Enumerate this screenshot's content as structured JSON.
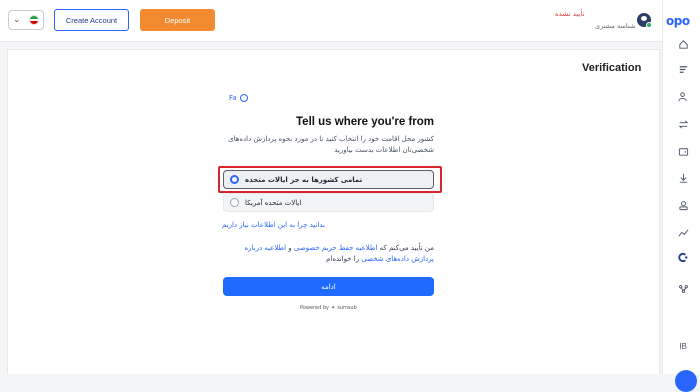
{
  "header": {
    "create_account_label": "Create Account",
    "deposit_label": "Deposit",
    "verification_status": "تأیید نشده",
    "account_label": "شناسه مشتری"
  },
  "sidebar": {
    "logo": "opo",
    "ib_label": "IB"
  },
  "page": {
    "title": "Verification",
    "language_link": "Fa"
  },
  "form": {
    "heading": "Tell us where you're from",
    "description": "کشور محل اقامت خود را انتخاب کنید تا در مورد نحوه پردازش داده‌های شخصی‌تان اطلاعات بدست بیاورید",
    "options": [
      {
        "label": "تمامی کشورها به جز ایالات متحده",
        "selected": true
      },
      {
        "label": "ایالات متحده آمریکا",
        "selected": false
      }
    ],
    "why_link": "بدانید چرا به این اطلاعات نیاز داریم",
    "consent_prefix": "من تأیید می‌کنم که",
    "consent_link1": "اطلاعیه حفظ حریم خصوصی",
    "consent_and": "و",
    "consent_link2": "اطلاعیه درباره پردازش داده‌های شخصی",
    "consent_suffix": "را خوانده‌ام",
    "continue_label": "ادامه",
    "powered_by": "Powered by",
    "brand": "sumsub"
  },
  "colors": {
    "accent": "#2b65ff",
    "deposit": "#f28a30",
    "highlight": "#d9262c",
    "status_error": "#e04848"
  }
}
